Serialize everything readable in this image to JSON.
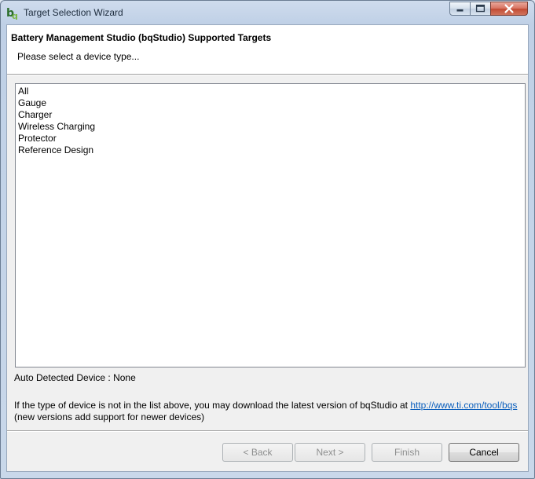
{
  "window": {
    "title": "Target Selection Wizard",
    "icon": "bq-app-icon"
  },
  "header": {
    "title": "Battery Management Studio (bqStudio) Supported Targets",
    "subtitle": "Please select a device type..."
  },
  "device_types": [
    "All",
    "Gauge",
    "Charger",
    "Wireless Charging",
    "Protector",
    "Reference Design"
  ],
  "auto_detect": {
    "text": "Auto Detected Device : None"
  },
  "info": {
    "line1_prefix": "If the type of device is not in the list above, you may download the latest version of bqStudio at ",
    "link": "http://www.ti.com/tool/bqs",
    "line2": "(new versions add support for newer devices)"
  },
  "buttons": {
    "back": "< Back",
    "next": "Next >",
    "finish": "Finish",
    "cancel": "Cancel"
  }
}
